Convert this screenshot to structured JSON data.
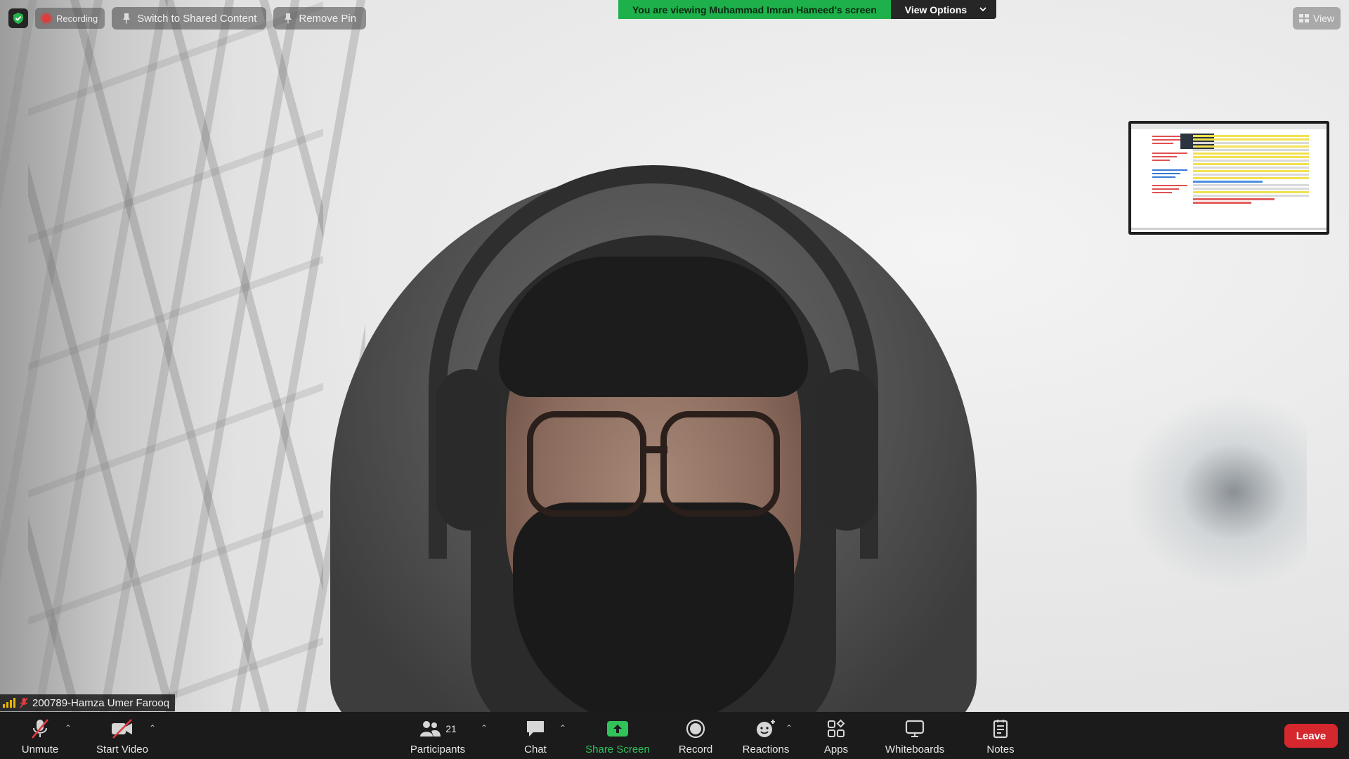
{
  "top_bar": {
    "recording_label": "Recording",
    "switch_label": "Switch to Shared Content",
    "remove_pin_label": "Remove Pin",
    "viewing_text": "You are viewing Muhammad Imran Hameed's screen",
    "view_options_label": "View Options",
    "view_label": "View"
  },
  "participant": {
    "name": "200789-Hamza Umer Farooq"
  },
  "toolbar": {
    "unmute": "Unmute",
    "start_video": "Start Video",
    "participants": "Participants",
    "participants_count": "21",
    "chat": "Chat",
    "share_screen": "Share Screen",
    "record": "Record",
    "reactions": "Reactions",
    "apps": "Apps",
    "whiteboards": "Whiteboards",
    "notes": "Notes",
    "leave": "Leave"
  },
  "colors": {
    "banner_green": "#1eb14b",
    "leave_red": "#d4282e",
    "share_green": "#31c259",
    "toolbar_bg": "#1b1b1b"
  }
}
